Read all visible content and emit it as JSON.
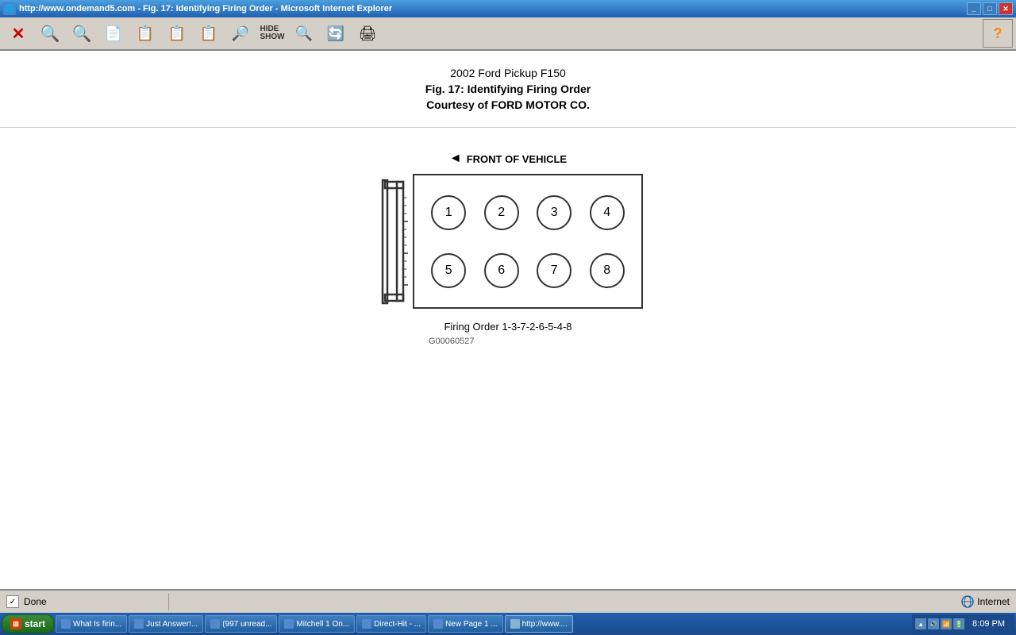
{
  "window": {
    "title": "http://www.ondemand5.com - Fig. 17: Identifying Firing Order - Microsoft Internet Explorer",
    "icon": "🌐"
  },
  "toolbar": {
    "buttons": [
      {
        "name": "close-btn",
        "label": "✕",
        "class": "icon-x"
      },
      {
        "name": "search-btn",
        "label": "🔍",
        "class": "icon-blue"
      },
      {
        "name": "nav-btn",
        "label": "🔍",
        "class": "icon-blue"
      },
      {
        "name": "fig-btn",
        "label": "📄",
        "class": "icon-gray"
      },
      {
        "name": "prev-btn",
        "label": "📋",
        "class": "icon-gray"
      },
      {
        "name": "view-btn",
        "label": "📋",
        "class": "icon-gray"
      },
      {
        "name": "next-btn",
        "label": "📋",
        "class": "icon-gray"
      },
      {
        "name": "find-btn",
        "label": "🔎",
        "class": "icon-gray"
      },
      {
        "name": "hide-show-btn",
        "label": "⊞",
        "class": "icon-gray"
      },
      {
        "name": "zoom-btn",
        "label": "🔍",
        "class": "icon-gray"
      },
      {
        "name": "refresh-btn",
        "label": "🔄",
        "class": "icon-gray"
      },
      {
        "name": "print-btn",
        "label": "🖨",
        "class": "icon-gray"
      }
    ],
    "help_label": "?"
  },
  "content": {
    "title1": "2002 Ford Pickup F150",
    "title2": "Fig. 17: Identifying Firing Order",
    "title3": "Courtesy of FORD MOTOR CO.",
    "front_label": "FRONT OF VEHICLE",
    "cylinders_top": [
      "1",
      "2",
      "3",
      "4"
    ],
    "cylinders_bottom": [
      "5",
      "6",
      "7",
      "8"
    ],
    "firing_order": "Firing Order 1-3-7-2-6-5-4-8",
    "diagram_code": "G00060527"
  },
  "status_bar": {
    "done_text": "Done",
    "zone_text": "Internet"
  },
  "taskbar": {
    "start_label": "start",
    "items": [
      {
        "label": "What Is firin...",
        "icon": "🔵"
      },
      {
        "label": "Just Answer!...",
        "icon": "🔵"
      },
      {
        "label": "(997 unread...",
        "icon": "🔵"
      },
      {
        "label": "Mitchell 1 On...",
        "icon": "🔵"
      },
      {
        "label": "Direct-Hit - ...",
        "icon": "🔵"
      },
      {
        "label": "New Page 1 ...",
        "icon": "🔵"
      },
      {
        "label": "http://www....",
        "icon": "🔵"
      }
    ],
    "time": "8:09 PM"
  }
}
